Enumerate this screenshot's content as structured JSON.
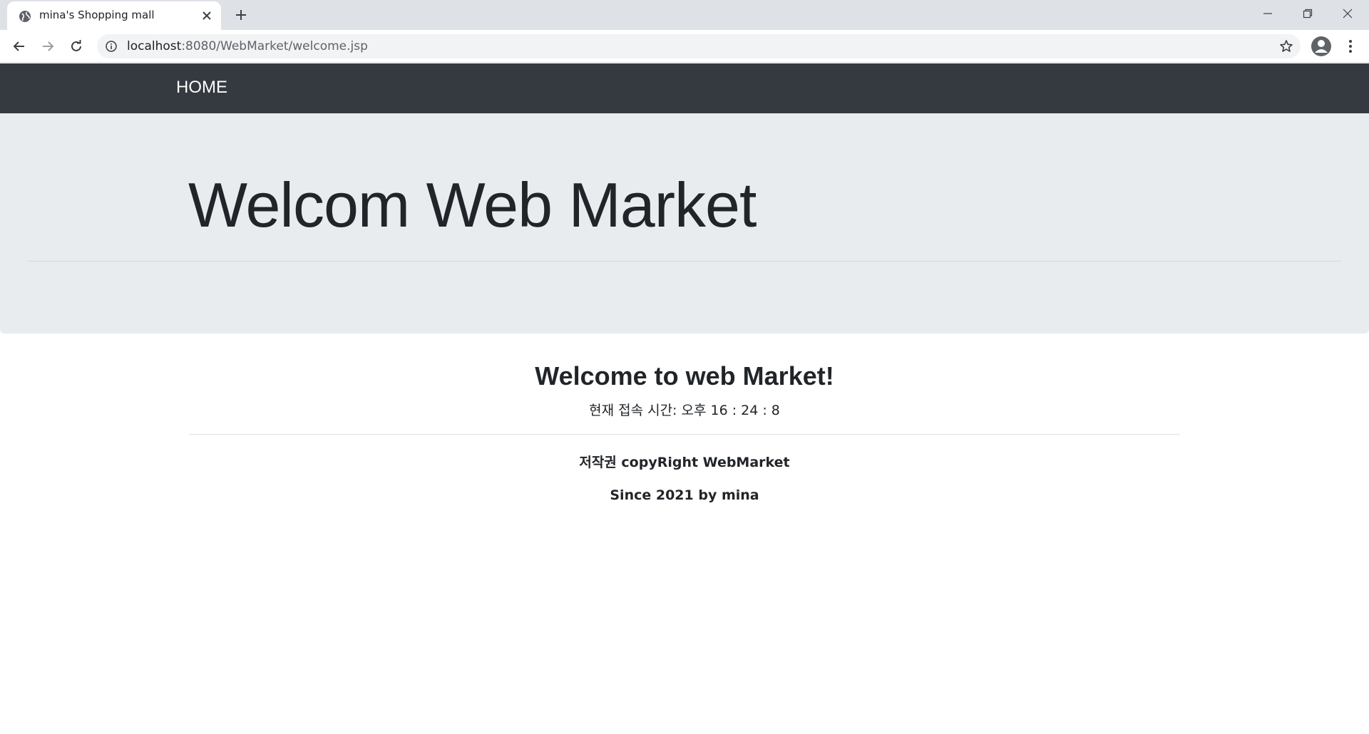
{
  "browser": {
    "tab_title": "mina's Shopping mall",
    "url_host": "localhost",
    "url_path": ":8080/WebMarket/welcome.jsp",
    "icons": [
      "globe-icon",
      "close-icon",
      "plus-icon",
      "minimize-icon",
      "restore-icon",
      "close-window-icon",
      "back-arrow-icon",
      "forward-arrow-icon",
      "reload-icon",
      "info-icon",
      "star-icon",
      "account-icon",
      "more-vert-icon"
    ]
  },
  "navbar": {
    "brand": "HOME",
    "background": "#343a40"
  },
  "jumbotron": {
    "title": "Welcom Web Market",
    "background": "#e9ecef"
  },
  "main": {
    "greeting": "Welcome to web Market!",
    "access_time": "현재 접속 시간: 오후 16 : 24 : 8"
  },
  "footer": {
    "copyright": "저작권 copyRight WebMarket",
    "since": "Since 2021 by mina"
  }
}
